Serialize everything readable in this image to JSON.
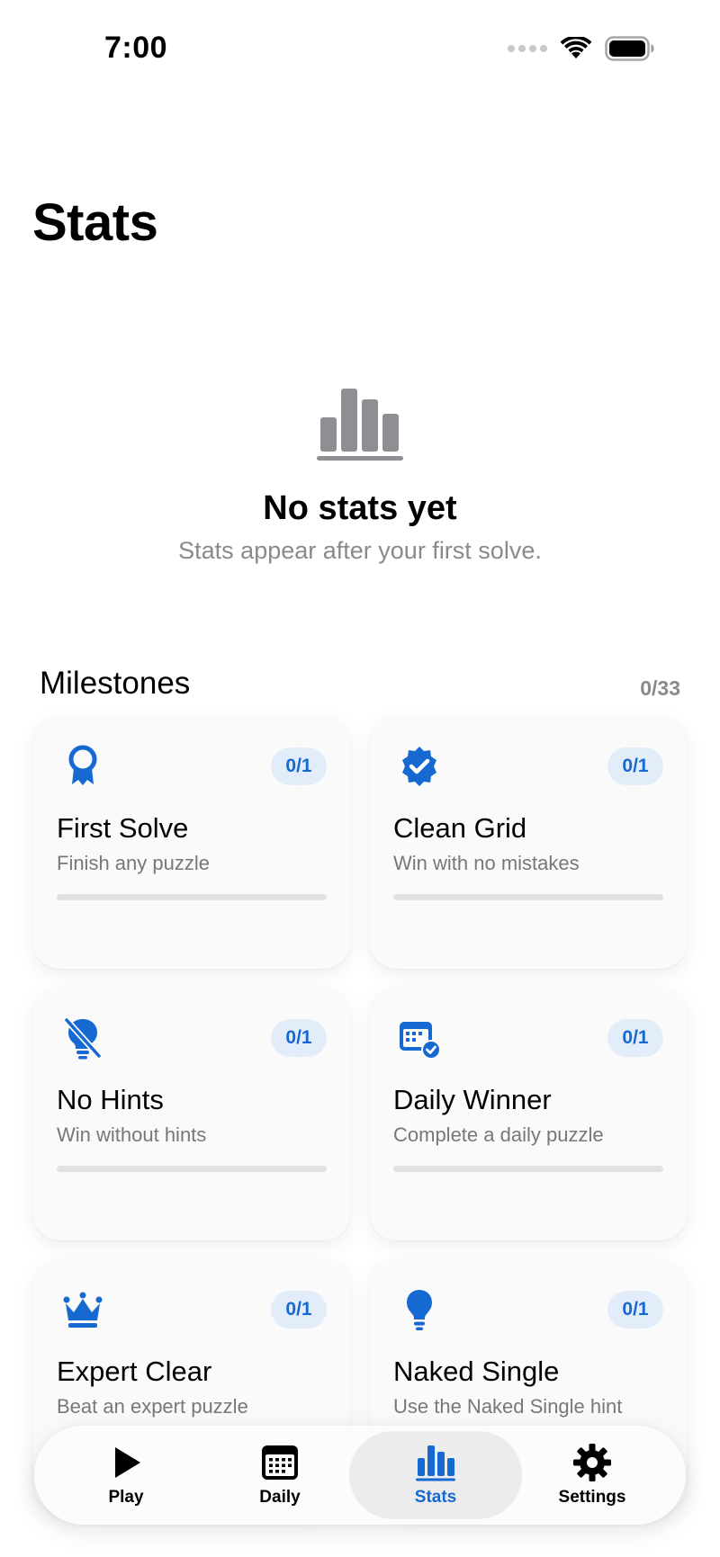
{
  "status_bar": {
    "time": "7:00"
  },
  "page": {
    "title": "Stats"
  },
  "empty_state": {
    "icon": "bar-chart-icon",
    "title": "No stats yet",
    "subtitle": "Stats appear after your first solve."
  },
  "milestones": {
    "title": "Milestones",
    "count": "0/33",
    "items": [
      {
        "title": "First Solve",
        "subtitle": "Finish any puzzle",
        "progress": "0/1",
        "progress_fraction": 0,
        "icon": "ribbon-award-icon"
      },
      {
        "title": "Clean Grid",
        "subtitle": "Win with no mistakes",
        "progress": "0/1",
        "progress_fraction": 0,
        "icon": "verified-check-badge-icon"
      },
      {
        "title": "No Hints",
        "subtitle": "Win without hints",
        "progress": "0/1",
        "progress_fraction": 0,
        "icon": "lightbulb-slash-icon"
      },
      {
        "title": "Daily Winner",
        "subtitle": "Complete a daily puzzle",
        "progress": "0/1",
        "progress_fraction": 0,
        "icon": "calendar-check-icon"
      },
      {
        "title": "Expert Clear",
        "subtitle": "Beat an expert puzzle",
        "progress": "0/1",
        "progress_fraction": 0,
        "icon": "crown-icon"
      },
      {
        "title": "Naked Single",
        "subtitle": "Use the Naked Single hint",
        "progress": "0/1",
        "progress_fraction": 0,
        "icon": "lightbulb-icon"
      }
    ]
  },
  "tabbar": {
    "tabs": [
      {
        "label": "Play",
        "icon": "play-icon",
        "active": false
      },
      {
        "label": "Daily",
        "icon": "calendar-icon",
        "active": false
      },
      {
        "label": "Stats",
        "icon": "bar-chart-icon",
        "active": true
      },
      {
        "label": "Settings",
        "icon": "gear-icon",
        "active": false
      }
    ]
  },
  "colors": {
    "accent": "#1769d2",
    "badge_bg": "#e3edfa",
    "secondary_text": "#8a8a8e",
    "empty_icon": "#8e8e93"
  }
}
